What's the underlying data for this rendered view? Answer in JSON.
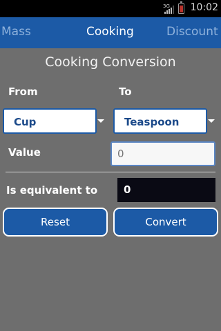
{
  "status_bar": {
    "network": "3G",
    "time": "10:02"
  },
  "tabs": [
    {
      "label": "Mass"
    },
    {
      "label": "Cooking"
    },
    {
      "label": "Discount"
    }
  ],
  "page": {
    "title": "Cooking Conversion"
  },
  "form": {
    "from_label": "From",
    "to_label": "To",
    "from_value": "Cup",
    "to_value": "Teaspoon",
    "value_label": "Value",
    "value_placeholder": "0",
    "equivalent_label": "Is equivalent to",
    "result": "0"
  },
  "buttons": {
    "reset": "Reset",
    "convert": "Convert"
  },
  "colors": {
    "accent": "#1c5aa6",
    "background": "#6e6e6e"
  }
}
